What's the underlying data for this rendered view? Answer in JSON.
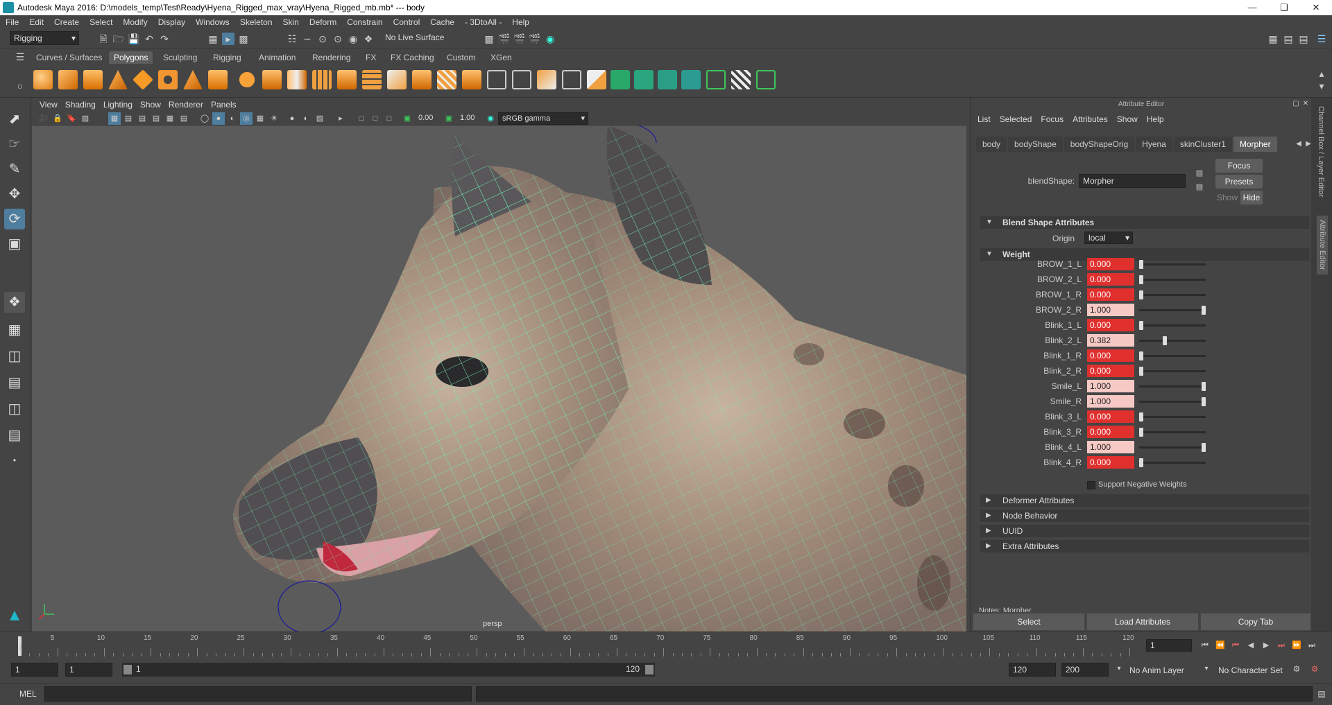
{
  "window": {
    "title": "Autodesk Maya 2016: D:\\models_temp\\Test\\Ready\\Hyena_Rigged_max_vray\\Hyena_Rigged_mb.mb*  ---  body"
  },
  "menubar": [
    "File",
    "Edit",
    "Create",
    "Select",
    "Modify",
    "Display",
    "Windows",
    "Skeleton",
    "Skin",
    "Deform",
    "Constrain",
    "Control",
    "Cache",
    "- 3DtoAll -",
    "Help"
  ],
  "toolbar": {
    "menuset": "Rigging",
    "live_surface": "No Live Surface"
  },
  "shelf": {
    "tabs": [
      "Curves / Surfaces",
      "Polygons",
      "Sculpting",
      "Rigging",
      "Animation",
      "Rendering",
      "FX",
      "FX Caching",
      "Custom",
      "XGen"
    ],
    "active": "Polygons"
  },
  "viewport": {
    "menu": [
      "View",
      "Shading",
      "Lighting",
      "Show",
      "Renderer",
      "Panels"
    ],
    "exposure": "0.00",
    "gamma": "1.00",
    "colorspace": "sRGB gamma",
    "camera": "persp"
  },
  "attribute_editor": {
    "header": "Attribute Editor",
    "menu": [
      "List",
      "Selected",
      "Focus",
      "Attributes",
      "Show",
      "Help"
    ],
    "tabs": [
      "body",
      "bodyShape",
      "bodyShapeOrig",
      "Hyena",
      "skinCluster1",
      "Morpher"
    ],
    "active_tab": "Morpher",
    "blendshape_label": "blendShape:",
    "blendshape_value": "Morpher",
    "focus": "Focus",
    "presets": "Presets",
    "show": "Show",
    "hide": "Hide",
    "section_blend": "Blend Shape Attributes",
    "origin_label": "Origin",
    "origin_value": "local",
    "section_weight": "Weight",
    "weights": [
      {
        "name": "BROW_1_L",
        "value": "0.000"
      },
      {
        "name": "BROW_2_L",
        "value": "0.000"
      },
      {
        "name": "BROW_1_R",
        "value": "0.000"
      },
      {
        "name": "BROW_2_R",
        "value": "1.000"
      },
      {
        "name": "Blink_1_L",
        "value": "0.000"
      },
      {
        "name": "Blink_2_L",
        "value": "0.382"
      },
      {
        "name": "Blink_1_R",
        "value": "0.000"
      },
      {
        "name": "Blink_2_R",
        "value": "0.000"
      },
      {
        "name": "Smile_L",
        "value": "1.000"
      },
      {
        "name": "Smile_R",
        "value": "1.000"
      },
      {
        "name": "Blink_3_L",
        "value": "0.000"
      },
      {
        "name": "Blink_3_R",
        "value": "0.000"
      },
      {
        "name": "Blink_4_L",
        "value": "1.000"
      },
      {
        "name": "Blink_4_R",
        "value": "0.000"
      }
    ],
    "support_negative": "Support Negative Weights",
    "sections_collapsed": [
      "Deformer Attributes",
      "Node Behavior",
      "UUID",
      "Extra Attributes"
    ],
    "notes": "Notes:  Morpher",
    "buttons": {
      "select": "Select",
      "load": "Load Attributes",
      "copy": "Copy Tab"
    }
  },
  "side_strip": {
    "channel_box": "Channel Box / Layer Editor",
    "attr_editor": "Attribute Editor"
  },
  "timeline": {
    "ticks": [
      "5",
      "10",
      "15",
      "20",
      "25",
      "30",
      "35",
      "40",
      "45",
      "50",
      "55",
      "60",
      "65",
      "70",
      "75",
      "80",
      "85",
      "90",
      "95",
      "100",
      "105",
      "110",
      "115",
      "120"
    ],
    "current_frame": "1",
    "current_marker": "1"
  },
  "range": {
    "start": "1",
    "playback_start": "1",
    "slider_start": "1",
    "slider_end": "120",
    "playback_end": "120",
    "end": "200",
    "anim_layer": "No Anim Layer",
    "char_set": "No Character Set"
  },
  "command": {
    "lang": "MEL"
  }
}
